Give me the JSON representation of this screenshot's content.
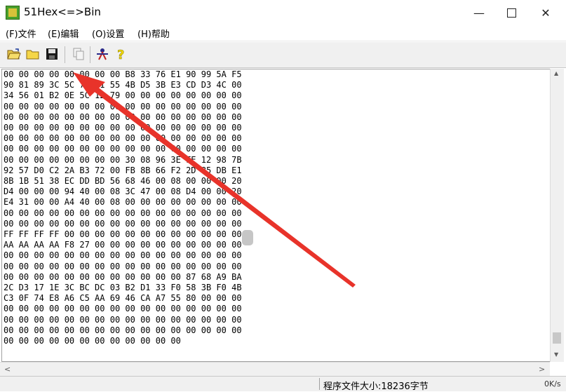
{
  "window": {
    "title": "51Hex<=>Bin"
  },
  "menu": [
    "(F)文件",
    "(E)编辑",
    "(O)设置",
    "(H)帮助"
  ],
  "toolbar": {
    "icons": [
      "open-file-icon",
      "folder-icon",
      "save-icon",
      "copy-icon",
      "convert-icon",
      "help-icon"
    ]
  },
  "hex": {
    "lines": [
      "00 00 00 00 00 00 00 00 B8 33 76 E1 90 99 5A F5",
      "90 81 89 3C 5C 78 E1 55 4B D5 3B E3 CD D3 4C 00",
      "34 56 01 B2 0E 5C 12 79 00 00 00 00 00 00 00 00",
      "00 00 00 00 00 00 00 00 00 00 00 00 00 00 00 00",
      "00 00 00 00 00 00 00 00 00 00 00 00 00 00 00 00",
      "00 00 00 00 00 00 00 00 00 00 00 00 00 00 00 00",
      "00 00 00 00 00 00 00 00 00 00 00 00 00 00 00 00",
      "00 00 00 00 00 00 00 00 00 00 00 00 00 00 00 00",
      "00 00 00 00 00 00 00 00 30 08 96 3E FE 12 98 7B",
      "92 57 D0 C2 2A B3 72 00 FB 8B 66 F2 2D 85 DB E1",
      "8B 1B 51 38 EC DD BD 56 68 46 00 08 00 00 00 20",
      "D4 00 00 00 94 40 00 08 3C 47 00 08 D4 00 00 20",
      "E4 31 00 00 A4 40 00 08 00 00 00 00 00 00 00 00",
      "00 00 00 00 00 00 00 00 00 00 00 00 00 00 00 00",
      "00 00 00 00 00 00 00 00 00 00 00 00 00 00 00 00",
      "FF FF FF FF 00 00 00 00 00 00 00 00 00 00 00 00",
      "AA AA AA AA F8 27 00 00 00 00 00 00 00 00 00 00",
      "00 00 00 00 00 00 00 00 00 00 00 00 00 00 00 00",
      "00 00 00 00 00 00 00 00 00 00 00 00 00 00 00 00",
      "00 00 00 00 00 00 00 00 00 00 00 00 87 68 A9 BA",
      "2C D3 17 1E 3C BC DC 03 B2 D1 33 F0 58 3B F0 4B",
      "C3 0F 74 E8 A6 C5 AA 69 46 CA A7 55 80 00 00 00",
      "00 00 00 00 00 00 00 00 00 00 00 00 00 00 00 00",
      "00 00 00 00 00 00 00 00 00 00 00 00 00 00 00 00",
      "00 00 00 00 00 00 00 00 00 00 00 00 00 00 00 00",
      "00 00 00 00 00 00 00 00 00 00 00 00"
    ]
  },
  "status": {
    "file_size": "程序文件大小:18236字节",
    "net": "0K/s"
  },
  "colors": {
    "annotation_arrow": "#e8332a"
  }
}
